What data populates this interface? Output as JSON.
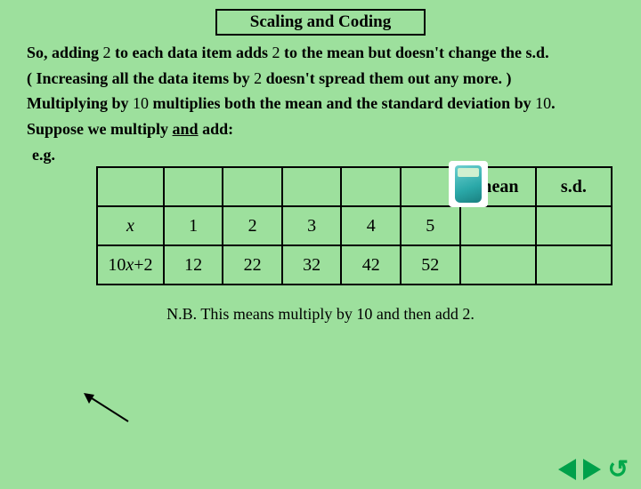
{
  "title": "Scaling and Coding",
  "para1a": "So, adding ",
  "para1_num1": "2",
  "para1b": " to each data item adds ",
  "para1_num2": "2",
  "para1c": " to the mean but doesn't change the s.d.",
  "para2a": "( Increasing all the data items by ",
  "para2_num": "2",
  "para2b": " doesn't spread them out any more. )",
  "para3a": "Multiplying by ",
  "para3_num1": "10",
  "para3b": " multiplies both the mean and the standard deviation by ",
  "para3_num2": "10",
  "para3c": ".",
  "para4a": "Suppose we multiply ",
  "para4_and": "and",
  "para4b": " add:",
  "eg_label": "e.g.",
  "chart_data": {
    "type": "table",
    "headers": [
      "",
      "",
      "",
      "",
      "",
      "",
      "mean",
      "s.d."
    ],
    "rows": [
      {
        "label": "x",
        "values": [
          "1",
          "2",
          "3",
          "4",
          "5"
        ],
        "mean": "",
        "sd": ""
      },
      {
        "label": "10x+2",
        "values": [
          "12",
          "22",
          "32",
          "42",
          "52"
        ],
        "mean": "",
        "sd": ""
      }
    ]
  },
  "note_a": "N.B. This means multiply by ",
  "note_num1": "10",
  "note_b": " and then add ",
  "note_num2": "2",
  "note_c": ".",
  "icons": {
    "calculator": "calculator-icon",
    "prev": "prev-icon",
    "next": "next-icon",
    "return": "return-icon"
  }
}
